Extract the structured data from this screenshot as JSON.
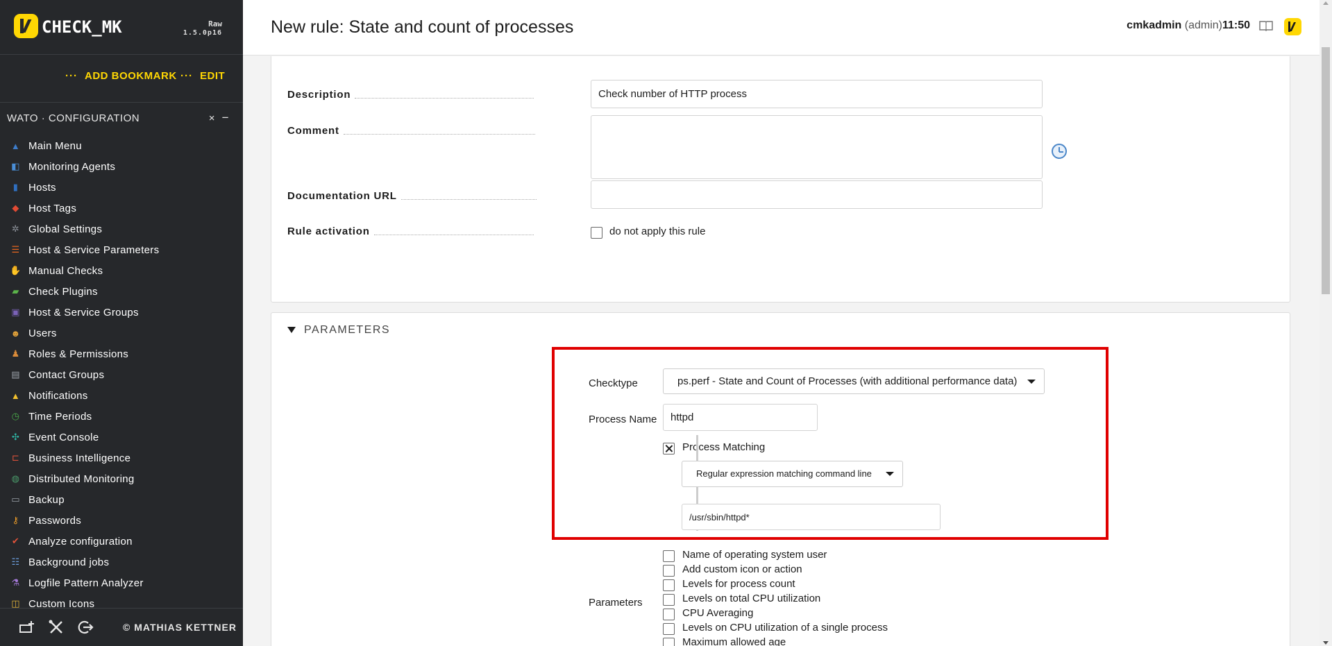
{
  "app": {
    "logo_text": "CHECK_MK",
    "edition": "Raw",
    "version": "1.5.0p16"
  },
  "bookmarks": {
    "dots": "···",
    "add_label": "ADD BOOKMARK",
    "edit_label": "EDIT"
  },
  "snapin": {
    "title": "WATO · CONFIGURATION",
    "close_glyph": "×",
    "minimize_glyph": "−"
  },
  "sidebar": {
    "items": [
      {
        "label": "Main Menu",
        "icon": "main-menu-icon",
        "color": "#3d7cc9"
      },
      {
        "label": "Monitoring Agents",
        "icon": "agents-icon",
        "color": "#4a8fd8"
      },
      {
        "label": "Hosts",
        "icon": "hosts-icon",
        "color": "#2f6fc0"
      },
      {
        "label": "Host Tags",
        "icon": "tag-icon",
        "color": "#e24b34"
      },
      {
        "label": "Global Settings",
        "icon": "gear-icon",
        "color": "#8a8f96"
      },
      {
        "label": "Host & Service Parameters",
        "icon": "rulesets-icon",
        "color": "#e7661f"
      },
      {
        "label": "Manual Checks",
        "icon": "hand-icon",
        "color": "#e8a45a"
      },
      {
        "label": "Check Plugins",
        "icon": "plugin-icon",
        "color": "#5bb34a"
      },
      {
        "label": "Host & Service Groups",
        "icon": "groups-icon",
        "color": "#7a62b7"
      },
      {
        "label": "Users",
        "icon": "users-icon",
        "color": "#e2a23a"
      },
      {
        "label": "Roles & Permissions",
        "icon": "roles-icon",
        "color": "#d98b3a"
      },
      {
        "label": "Contact Groups",
        "icon": "contact-groups-icon",
        "color": "#9aa0a8"
      },
      {
        "label": "Notifications",
        "icon": "bell-icon",
        "color": "#f2c12e"
      },
      {
        "label": "Time Periods",
        "icon": "clock-icon",
        "color": "#4aa84a"
      },
      {
        "label": "Event Console",
        "icon": "event-console-icon",
        "color": "#2fb3a3"
      },
      {
        "label": "Business Intelligence",
        "icon": "bi-icon",
        "color": "#d9503a"
      },
      {
        "label": "Distributed Monitoring",
        "icon": "globe-icon",
        "color": "#4a9a6a"
      },
      {
        "label": "Backup",
        "icon": "backup-icon",
        "color": "#9aa0a8"
      },
      {
        "label": "Passwords",
        "icon": "key-icon",
        "color": "#e89a2a"
      },
      {
        "label": "Analyze configuration",
        "icon": "analyze-icon",
        "color": "#e2533a"
      },
      {
        "label": "Background jobs",
        "icon": "list-icon",
        "color": "#6ea0e0"
      },
      {
        "label": "Logfile Pattern Analyzer",
        "icon": "flask-icon",
        "color": "#a57ad9"
      },
      {
        "label": "Custom Icons",
        "icon": "custom-icons-icon",
        "color": "#e2b43a"
      }
    ]
  },
  "footer": {
    "copyright": "© MATHIAS KETTNER"
  },
  "header": {
    "title": "New rule: State and count of processes",
    "user": "cmkadmin",
    "role": "(admin)",
    "time": "11:50"
  },
  "properties": {
    "description_label": "Description",
    "description_value": "Check number of HTTP process",
    "comment_label": "Comment",
    "comment_value": "",
    "doc_url_label": "Documentation URL",
    "doc_url_value": "",
    "activation_label": "Rule activation",
    "activation_option": "do not apply this rule"
  },
  "parameters": {
    "section_title": "PARAMETERS",
    "checktype_label": "Checktype",
    "checktype_value": "ps.perf - State and Count of Processes (with additional performance data)",
    "process_name_label": "Process Name",
    "process_name_value": "httpd",
    "process_matching_label": "Process Matching",
    "matching_mode_value": "Regular expression matching command line",
    "regex_value": "/usr/sbin/httpd*",
    "parameters_label": "Parameters",
    "options": [
      "Name of operating system user",
      "Add custom icon or action",
      "Levels for process count",
      "Levels on total CPU utilization",
      "CPU Averaging",
      "Levels on CPU utilization of a single process",
      "Maximum allowed age"
    ]
  }
}
